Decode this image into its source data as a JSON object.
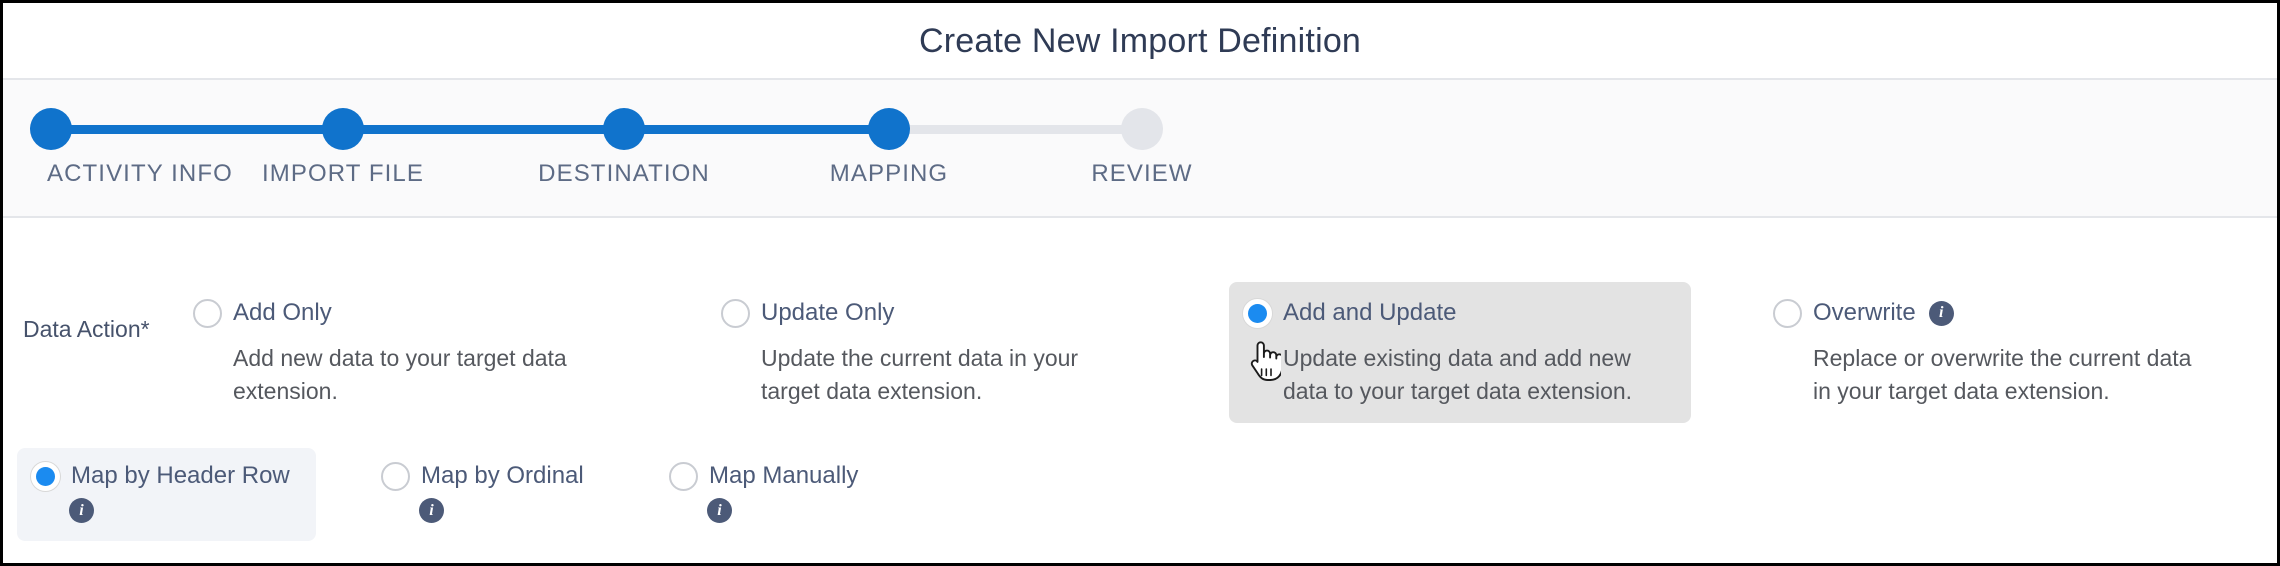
{
  "header": {
    "title": "Create New Import Definition"
  },
  "stepper": {
    "steps": [
      {
        "label": "ACTIVITY INFO",
        "state": "done"
      },
      {
        "label": "IMPORT FILE",
        "state": "done"
      },
      {
        "label": "DESTINATION",
        "state": "done"
      },
      {
        "label": "MAPPING",
        "state": "done"
      },
      {
        "label": "REVIEW",
        "state": "todo"
      }
    ],
    "active_color": "#1073cc",
    "inactive_color": "#e3e5ea"
  },
  "data_action": {
    "label": "Data Action*",
    "selected": "Add and Update",
    "options": [
      {
        "title": "Add Only",
        "description": "Add new data to your target data extension.",
        "selected": false,
        "has_info": false
      },
      {
        "title": "Update Only",
        "description": "Update the current data in your target data extension.",
        "selected": false,
        "has_info": false
      },
      {
        "title": "Add and Update",
        "description": "Update existing data and add new data to your target data extension.",
        "selected": true,
        "has_info": false
      },
      {
        "title": "Overwrite",
        "description": "Replace or overwrite the current data in your target data extension.",
        "selected": false,
        "has_info": true,
        "info_glyph": "i"
      }
    ]
  },
  "mapping": {
    "selected": "Map by Header Row",
    "options": [
      {
        "title": "Map by Header Row",
        "selected": true,
        "info_glyph": "i"
      },
      {
        "title": "Map by Ordinal",
        "selected": false,
        "info_glyph": "i"
      },
      {
        "title": "Map Manually",
        "selected": false,
        "info_glyph": "i"
      }
    ]
  },
  "colors": {
    "accent_blue": "#1b8bf0",
    "step_blue": "#1073cc",
    "title_navy": "#2f3b55",
    "label_slate": "#4c5a78",
    "highlight_gray": "#e3e3e3"
  }
}
